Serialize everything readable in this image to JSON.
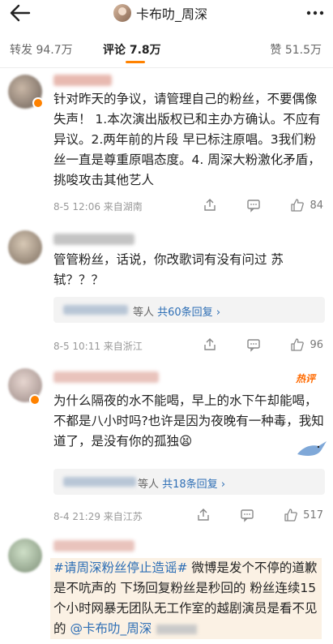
{
  "header": {
    "title": "卡布叻_周深"
  },
  "tabs": {
    "repost": "转发 94.7万",
    "comment": "评论 7.8万",
    "like": "赞 51.5万"
  },
  "comments": [
    {
      "text": "针对昨天的争议，请管理自己的粉丝，不要偶像失声！ 1.本次演出版权已和主办方确认。不应有异议。2.两年前的片段 早已标注原唱。3我们粉丝一直是尊重原唱态度。4. 周深大粉激化矛盾，挑唆攻击其他艺人",
      "meta": "8-5 12:06  来自湖南",
      "likes": "84"
    },
    {
      "text": "管管粉丝，话说，你改歌词有没有问过 苏轼？？？",
      "reply_suffix": "等人 ",
      "reply_link": "共60条回复 ›",
      "meta": "8-5 10:11  来自浙江",
      "likes": "96"
    },
    {
      "text": "为什么隔夜的水不能喝，早上的水下午却能喝，不都是八小时吗?也许是因为夜晚有一种毒，我知道了，是没有你的孤独😫",
      "hot_label": "热评",
      "reply_suffix": "等人 ",
      "reply_link": "共18条回复 ›",
      "meta": "8-4 21:29  来自江苏",
      "likes": "517"
    },
    {
      "hashtag": "#请周深粉丝停止造谣#",
      "text": " 微博是发个不停的道歉是不吭声的 下场回复粉丝是秒回的 粉丝连续15个小时网暴无团队无工作室的越剧演员是看不见的 ",
      "mention": "@卡布叻_周深"
    }
  ],
  "icons": {
    "back": "arrow-left-icon",
    "more": "more-dots-icon",
    "share": "share-icon",
    "reply": "comment-icon",
    "like": "thumbs-up-icon"
  },
  "colors": {
    "accent": "#ff8200",
    "link": "#2d6eb5"
  }
}
